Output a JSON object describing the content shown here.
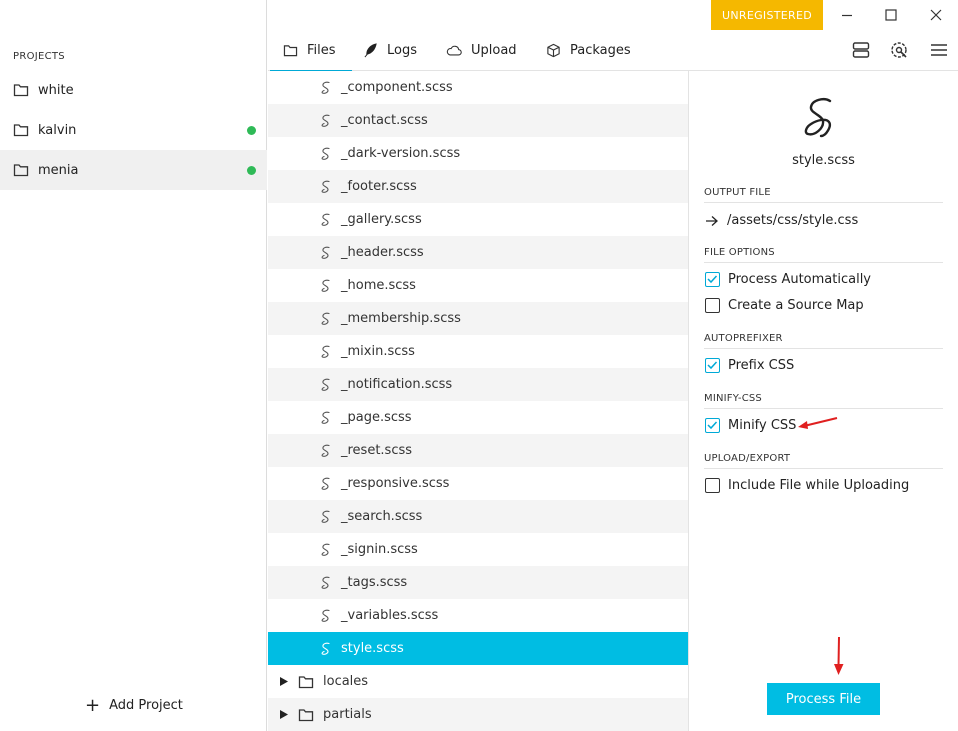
{
  "sidebar": {
    "header": "PROJECTS",
    "projects": [
      {
        "name": "white",
        "status": false
      },
      {
        "name": "kalvin",
        "status": true
      },
      {
        "name": "menia",
        "status": true
      }
    ],
    "add_label": "Add Project"
  },
  "titlebar": {
    "unregistered": "UNREGISTERED"
  },
  "tabs": [
    {
      "label": "Files",
      "icon": "folder-icon"
    },
    {
      "label": "Logs",
      "icon": "feather-icon"
    },
    {
      "label": "Upload",
      "icon": "cloud-icon"
    },
    {
      "label": "Packages",
      "icon": "box-icon"
    }
  ],
  "files": [
    "_component.scss",
    "_contact.scss",
    "_dark-version.scss",
    "_footer.scss",
    "_gallery.scss",
    "_header.scss",
    "_home.scss",
    "_membership.scss",
    "_mixin.scss",
    "_notification.scss",
    "_page.scss",
    "_reset.scss",
    "_responsive.scss",
    "_search.scss",
    "_signin.scss",
    "_tags.scss",
    "_variables.scss",
    "style.scss"
  ],
  "folders": [
    "locales",
    "partials"
  ],
  "panel": {
    "file_name": "style.scss",
    "output_header": "OUTPUT FILE",
    "output_path": "/assets/css/style.css",
    "file_options_header": "FILE OPTIONS",
    "process_auto": "Process Automatically",
    "source_map": "Create a Source Map",
    "autoprefixer_header": "AUTOPREFIXER",
    "prefix_css": "Prefix CSS",
    "minify_header": "MINIFY-CSS",
    "minify_css": "Minify CSS",
    "upload_header": "UPLOAD/EXPORT",
    "include_upload": "Include File while Uploading",
    "process_button": "Process File"
  },
  "colors": {
    "accent": "#00bde3",
    "status": "#2fba57",
    "warning": "#f5b800"
  }
}
